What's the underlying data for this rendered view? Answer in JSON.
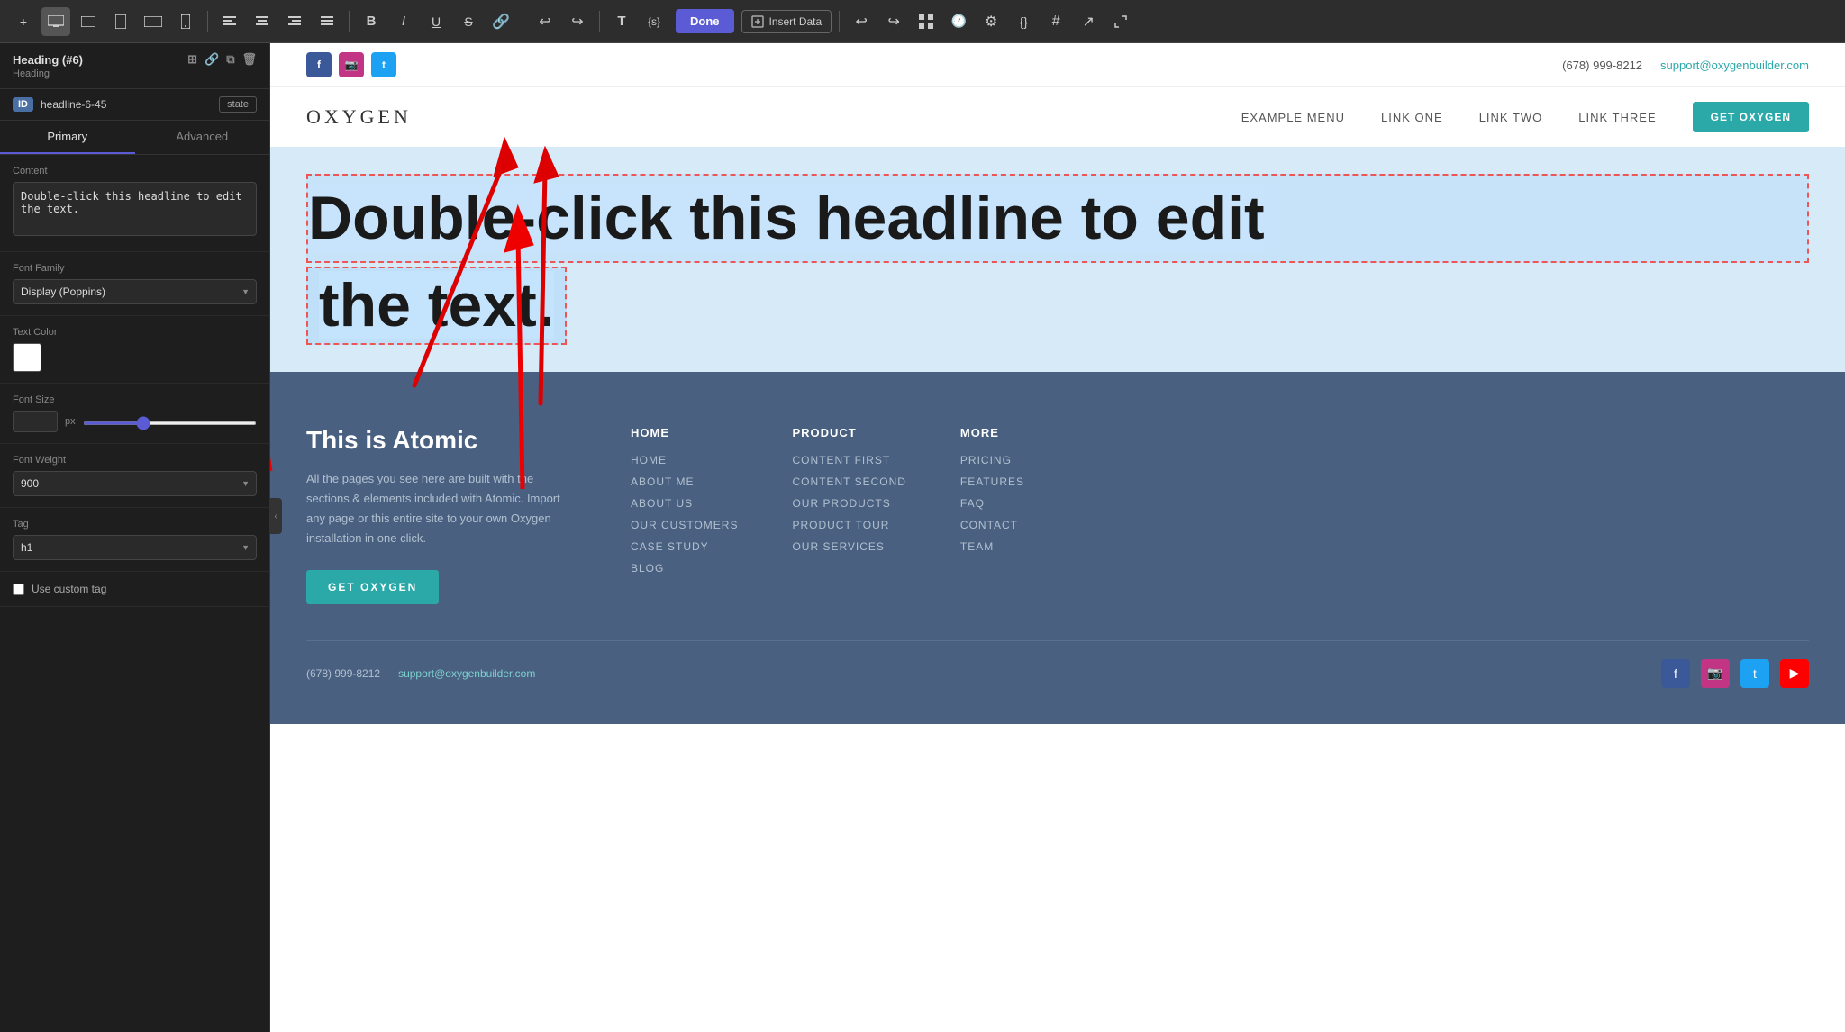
{
  "toolbar": {
    "align_left": "≡",
    "align_center": "≡",
    "align_right": "≡",
    "align_justify": "≡",
    "bold": "B",
    "italic": "I",
    "underline": "U",
    "strikethrough": "S",
    "link": "🔗",
    "undo": "↩",
    "redo": "↪",
    "text_tool": "T",
    "dynamic": "{s}",
    "done_label": "Done",
    "insert_data_label": "Insert Data",
    "toolbar_icons": [
      "⊞",
      "▭",
      "▭",
      "▭",
      "📱"
    ]
  },
  "sidebar": {
    "component_title": "Heading (#6)",
    "component_subtitle": "Heading",
    "id_label": "ID",
    "id_value": "headline-6-45",
    "state_label": "state",
    "tab_primary": "Primary",
    "tab_advanced": "Advanced",
    "content_label": "Content",
    "content_value": "Double-click this headline to edit the text.",
    "font_family_label": "Font Family",
    "font_family_value": "Display (Poppins)",
    "text_color_label": "Text Color",
    "font_size_label": "Font Size",
    "font_size_unit": "px",
    "font_weight_label": "Font Weight",
    "tag_label": "Tag",
    "tag_value": "h1",
    "use_custom_tag_label": "Use custom tag"
  },
  "website": {
    "topbar": {
      "phone": "(678) 999-8212",
      "email": "support@oxygenbuilder.com"
    },
    "nav": {
      "logo": "OXYGEN",
      "links": [
        "EXAMPLE MENU",
        "LINK ONE",
        "LINK TWO",
        "LINK THREE"
      ],
      "cta": "GET OXYGEN"
    },
    "hero": {
      "heading_line1": "Double-click this headline to edit",
      "heading_line2": "the text."
    },
    "footer": {
      "brand_title": "This is Atomic",
      "brand_text": "All the pages you see here are built with the sections & elements included with Atomic. Import any page or this entire site to your own Oxygen installation in one click.",
      "cta": "GET OXYGEN",
      "col1_title": "HOME",
      "col1_links": [
        "HOME",
        "ABOUT ME",
        "ABOUT US",
        "OUR CUSTOMERS",
        "CASE STUDY",
        "BLOG"
      ],
      "col2_title": "PRODUCT",
      "col2_links": [
        "CONTENT FIRST",
        "CONTENT SECOND",
        "OUR PRODUCTS",
        "PRODUCT TOUR",
        "OUR SERVICES"
      ],
      "col3_title": "MORE",
      "col3_links": [
        "PRICING",
        "FEATURES",
        "FAQ",
        "CONTACT",
        "TEAM"
      ],
      "phone": "(678) 999-8212",
      "email": "support@oxygenbuilder.com"
    }
  }
}
